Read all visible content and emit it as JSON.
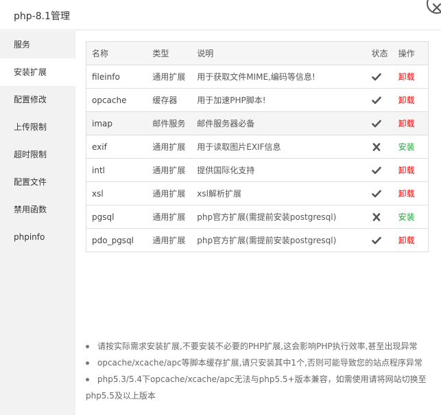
{
  "window": {
    "title": "php-8.1管理"
  },
  "sidebar": {
    "items": [
      {
        "label": "服务"
      },
      {
        "label": "安装扩展"
      },
      {
        "label": "配置修改"
      },
      {
        "label": "上传限制"
      },
      {
        "label": "超时限制"
      },
      {
        "label": "配置文件"
      },
      {
        "label": "禁用函数"
      },
      {
        "label": "phpinfo"
      }
    ],
    "active_index": 1
  },
  "table": {
    "headers": {
      "name": "名称",
      "type": "类型",
      "desc": "说明",
      "state": "状态",
      "op": "操作"
    },
    "rows": [
      {
        "name": "fileinfo",
        "type": "通用扩展",
        "desc": "用于获取文件MIME,编码等信息!",
        "installed": true,
        "op": "卸载"
      },
      {
        "name": "opcache",
        "type": "缓存器",
        "desc": "用于加速PHP脚本!",
        "installed": true,
        "op": "卸载"
      },
      {
        "name": "imap",
        "type": "邮件服务",
        "desc": "邮件服务器必备",
        "installed": true,
        "op": "卸载"
      },
      {
        "name": "exif",
        "type": "通用扩展",
        "desc": "用于读取图片EXIF信息",
        "installed": false,
        "op": "安装"
      },
      {
        "name": "intl",
        "type": "通用扩展",
        "desc": "提供国际化支持",
        "installed": true,
        "op": "卸载"
      },
      {
        "name": "xsl",
        "type": "通用扩展",
        "desc": "xsl解析扩展",
        "installed": true,
        "op": "卸载"
      },
      {
        "name": "pgsql",
        "type": "通用扩展",
        "desc": "php官方扩展(需提前安装postgresql)",
        "installed": false,
        "op": "安装"
      },
      {
        "name": "pdo_pgsql",
        "type": "通用扩展",
        "desc": "php官方扩展(需提前安装postgresql)",
        "installed": true,
        "op": "卸载"
      }
    ]
  },
  "notes": [
    "请按实际需求安装扩展,不要安装不必要的PHP扩展,这会影响PHP执行效率,甚至出现异常",
    "opcache/xcache/apc等脚本缓存扩展,请只安装其中1个,否则可能导致您的站点程序异常",
    "php5.3/5.4下opcache/xcache/apc无法与php5.5+版本兼容，如需使用请将网站切换至php5.5及以上版本"
  ],
  "colors": {
    "uninstall": "#ff0000",
    "install": "#20a53a"
  },
  "icons": {
    "installed": "check-icon",
    "not_installed": "cross-icon",
    "close": "close-icon"
  }
}
